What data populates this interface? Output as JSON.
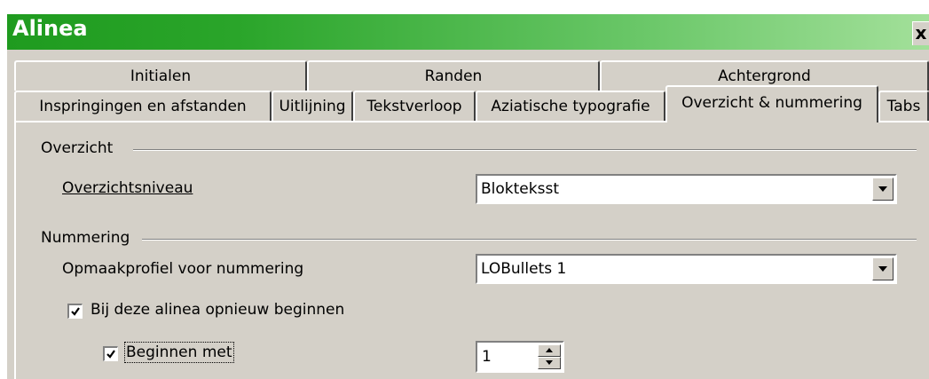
{
  "window": {
    "title": "Alinea",
    "close_label": "x"
  },
  "tabs_back": [
    {
      "label": "Initialen"
    },
    {
      "label": "Randen"
    },
    {
      "label": "Achtergrond"
    }
  ],
  "tabs_front": [
    {
      "label": "Inspringingen en afstanden"
    },
    {
      "label": "Uitlijning"
    },
    {
      "label": "Tekstverloop"
    },
    {
      "label": "Aziatische typografie"
    },
    {
      "label": "Overzicht & nummering",
      "active": true
    },
    {
      "label": "Tabs"
    }
  ],
  "outline": {
    "group_label": "Overzicht",
    "level_label": "Overzichtsniveau",
    "level_value": "Blokteksst"
  },
  "numbering": {
    "group_label": "Nummering",
    "style_label": "Opmaakprofiel voor nummering",
    "style_value": "LOBullets 1",
    "restart_label": "Bij deze alinea opnieuw beginnen",
    "restart_checked": true,
    "start_label": "Beginnen met",
    "start_checked": true,
    "start_value": "1"
  }
}
